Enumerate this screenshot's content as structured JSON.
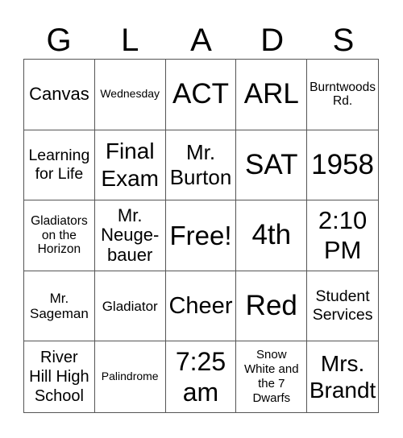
{
  "card": {
    "header": [
      "G",
      "L",
      "A",
      "D",
      "S"
    ],
    "rows": [
      [
        "Canvas",
        "Wednesday",
        "ACT",
        "ARL",
        "Burntwoods\nRd."
      ],
      [
        "Learning\nfor Life",
        "Final\nExam",
        "Mr.\nBurton",
        "SAT",
        "1958"
      ],
      [
        "Gladiators\non the\nHorizon",
        "Mr.\nNeuge-\nbauer",
        "Free!",
        "4th",
        "2:10\nPM"
      ],
      [
        "Mr.\nSageman",
        "Gladiator",
        "Cheer",
        "Red",
        "Student\nServices"
      ],
      [
        "River\nHill High\nSchool",
        "Palindrome",
        "7:25\nam",
        "Snow\nWhite and\nthe 7\nDwarfs",
        "Mrs.\nBrandt"
      ]
    ]
  }
}
